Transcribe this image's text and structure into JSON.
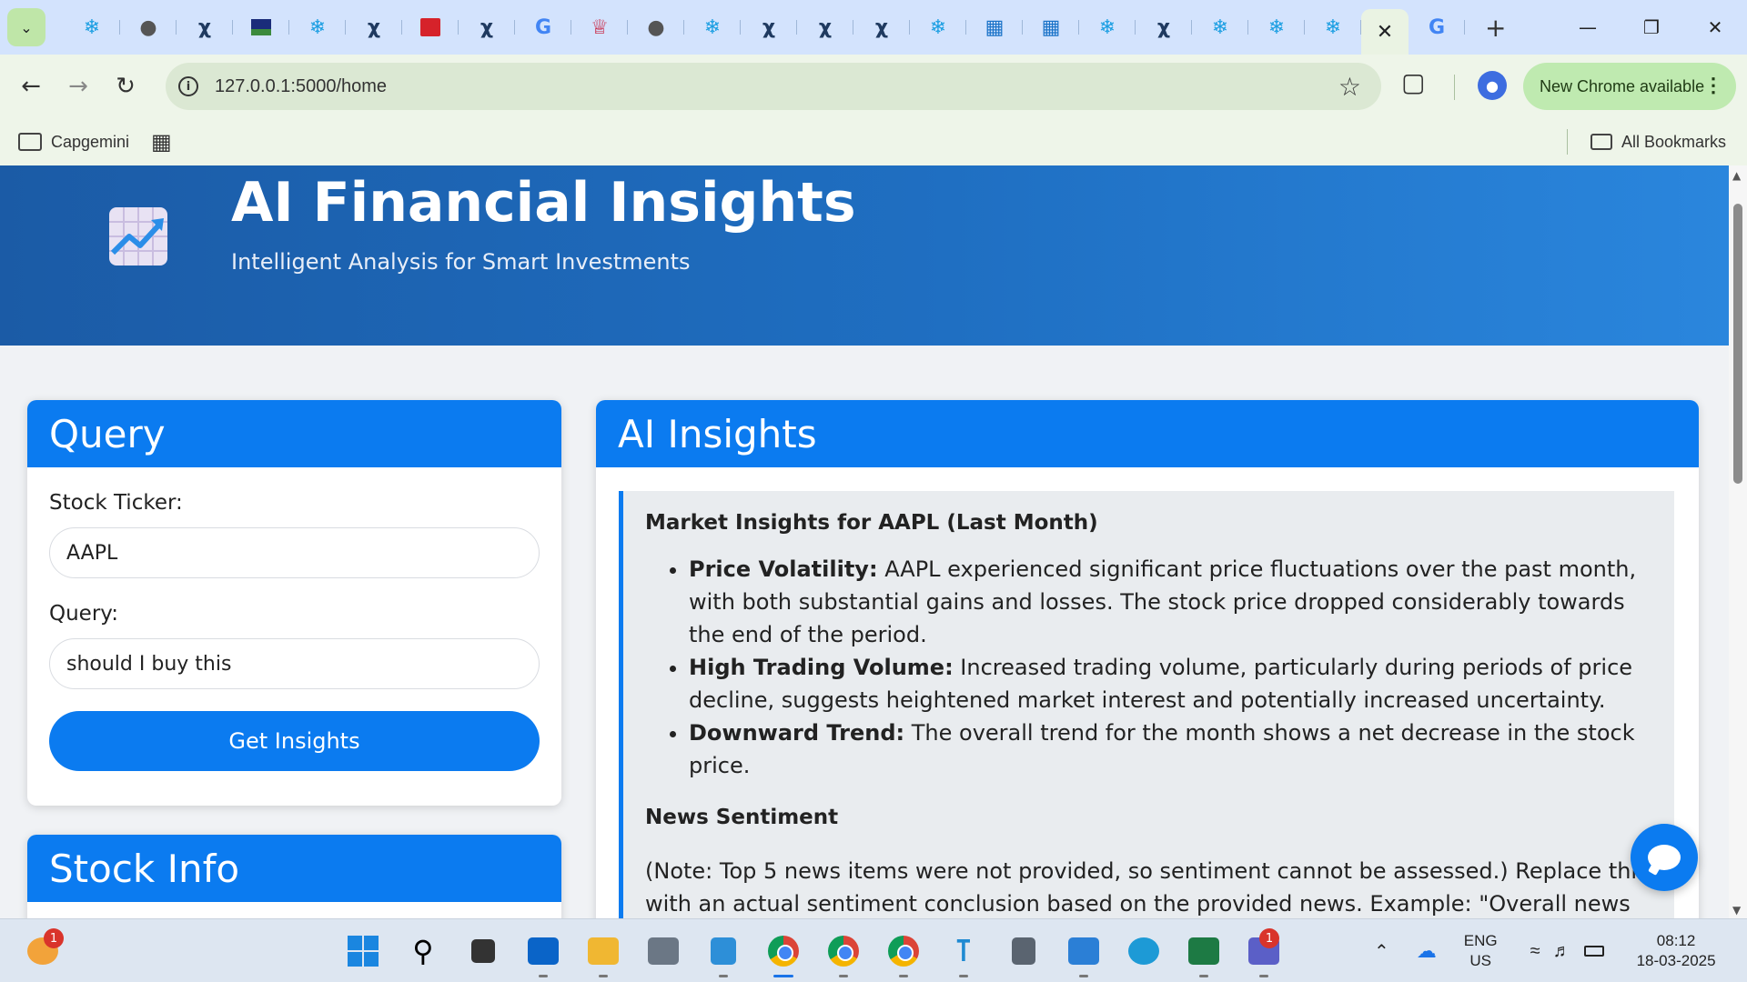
{
  "browser": {
    "url": "127.0.0.1:5000/home",
    "update_label": "New Chrome available",
    "bookmarks": {
      "folder": "Capgemini",
      "all_bookmarks": "All Bookmarks"
    }
  },
  "hero": {
    "title": "AI Financial Insights",
    "subtitle": "Intelligent Analysis for Smart Investments"
  },
  "query_card": {
    "title": "Query",
    "ticker_label": "Stock Ticker:",
    "ticker_value": "AAPL",
    "query_label": "Query:",
    "query_value": "should I buy this",
    "submit_label": "Get Insights"
  },
  "stock_card": {
    "title": "Stock Info"
  },
  "insights_card": {
    "title": "AI Insights",
    "heading": "Market Insights for AAPL (Last Month)",
    "points": [
      {
        "label": "Price Volatility:",
        "text": " AAPL experienced significant price fluctuations over the past month, with both substantial gains and losses. The stock price dropped considerably towards the end of the period."
      },
      {
        "label": "High Trading Volume:",
        "text": " Increased trading volume, particularly during periods of price decline, suggests heightened market interest and potentially increased uncertainty."
      },
      {
        "label": "Downward Trend:",
        "text": " The overall trend for the month shows a net decrease in the stock price."
      }
    ],
    "news_heading": "News Sentiment",
    "news_text": "(Note: Top 5 news items were not provided, so sentiment cannot be assessed.) Replace this with an actual sentiment conclusion based on the provided news. Example: \"Overall news"
  },
  "taskbar": {
    "weather_badge": "1",
    "teams_badge": "1",
    "lang_line1": "ENG",
    "lang_line2": "US",
    "time": "08:12",
    "date": "18-03-2025"
  },
  "colors": {
    "primary": "#0b7bf0",
    "hero_start": "#1b5ba6",
    "hero_end": "#2a86dd",
    "panel_bg": "#e9ecef"
  }
}
